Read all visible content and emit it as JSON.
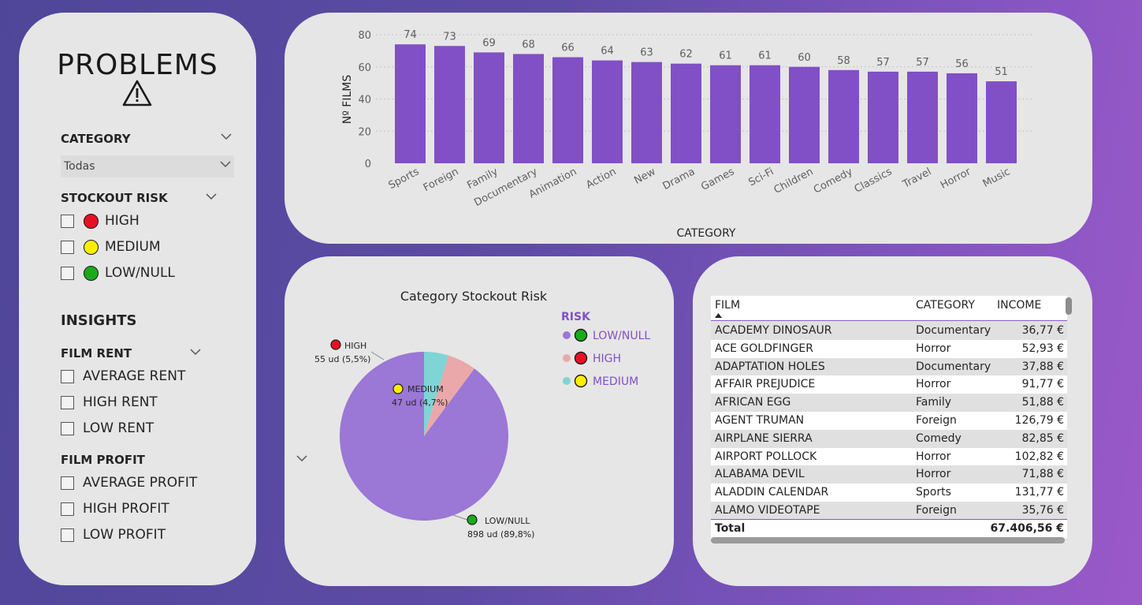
{
  "filters": {
    "title": "PROBLEMS",
    "category": {
      "label": "CATEGORY",
      "selected": "Todas"
    },
    "stockout_risk": {
      "label": "STOCKOUT RISK",
      "options": [
        {
          "label": "HIGH",
          "color": "#e81123"
        },
        {
          "label": "MEDIUM",
          "color": "#ffee00"
        },
        {
          "label": "LOW/NULL",
          "color": "#1aaa1a"
        }
      ]
    },
    "insights_title": "INSIGHTS",
    "film_rent": {
      "label": "FILM RENT",
      "options": [
        "AVERAGE RENT",
        "HIGH RENT",
        "LOW RENT"
      ]
    },
    "film_profit": {
      "label": "FILM PROFIT",
      "options": [
        "AVERAGE PROFIT",
        "HIGH PROFIT",
        "LOW PROFIT"
      ]
    }
  },
  "chart_data": [
    {
      "type": "bar",
      "categories": [
        "Sports",
        "Foreign",
        "Family",
        "Documentary",
        "Animation",
        "Action",
        "New",
        "Drama",
        "Games",
        "Sci-Fi",
        "Children",
        "Comedy",
        "Classics",
        "Travel",
        "Horror",
        "Music"
      ],
      "values": [
        74,
        73,
        69,
        68,
        66,
        64,
        63,
        62,
        61,
        61,
        60,
        58,
        57,
        57,
        56,
        51
      ],
      "title": "",
      "xlabel": "CATEGORY",
      "ylabel": "Nº FILMS",
      "ylim": [
        0,
        80
      ],
      "yticks": [
        0,
        20,
        40,
        60,
        80
      ],
      "grid": true,
      "color": "#8150c6"
    },
    {
      "type": "pie",
      "title": "Category Stockout Risk",
      "legend_title": "RISK",
      "legend_position": "right",
      "slices": [
        {
          "name": "LOW/NULL",
          "value": 898,
          "label": "898 ud (89,8%)",
          "color": "#9b77d6",
          "dot": "#1aaa1a"
        },
        {
          "name": "HIGH",
          "value": 55,
          "label": "55 ud (5,5%)",
          "color": "#eba8aa",
          "dot": "#e81123"
        },
        {
          "name": "MEDIUM",
          "value": 47,
          "label": "47 ud (4,7%)",
          "color": "#7fd4d6",
          "dot": "#ffee00"
        }
      ]
    }
  ],
  "table": {
    "columns": [
      "FILM",
      "CATEGORY",
      "INCOME"
    ],
    "rows": [
      [
        "ACADEMY DINOSAUR",
        "Documentary",
        "36,77 €"
      ],
      [
        "ACE GOLDFINGER",
        "Horror",
        "52,93 €"
      ],
      [
        "ADAPTATION HOLES",
        "Documentary",
        "37,88 €"
      ],
      [
        "AFFAIR PREJUDICE",
        "Horror",
        "91,77 €"
      ],
      [
        "AFRICAN EGG",
        "Family",
        "51,88 €"
      ],
      [
        "AGENT TRUMAN",
        "Foreign",
        "126,79 €"
      ],
      [
        "AIRPLANE SIERRA",
        "Comedy",
        "82,85 €"
      ],
      [
        "AIRPORT POLLOCK",
        "Horror",
        "102,82 €"
      ],
      [
        "ALABAMA DEVIL",
        "Horror",
        "71,88 €"
      ],
      [
        "ALADDIN CALENDAR",
        "Sports",
        "131,77 €"
      ],
      [
        "ALAMO VIDEOTAPE",
        "Foreign",
        "35,76 €"
      ]
    ],
    "total_label": "Total",
    "total_value": "67.406,56 €"
  }
}
